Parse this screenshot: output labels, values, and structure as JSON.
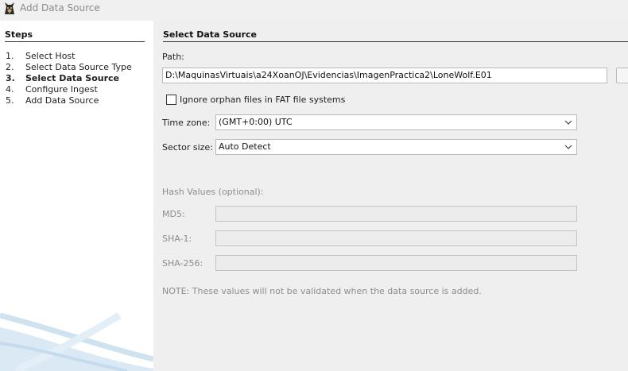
{
  "window": {
    "title": "Add Data Source"
  },
  "steps": {
    "title": "Steps",
    "items": [
      {
        "num": "1.",
        "label": "Select Host",
        "active": false
      },
      {
        "num": "2.",
        "label": "Select Data Source Type",
        "active": false
      },
      {
        "num": "3.",
        "label": "Select Data Source",
        "active": true
      },
      {
        "num": "4.",
        "label": "Configure Ingest",
        "active": false
      },
      {
        "num": "5.",
        "label": "Add Data Source",
        "active": false
      }
    ]
  },
  "form": {
    "title": "Select Data Source",
    "path_label": "Path:",
    "path_value": "D:\\MaquinasVirtuais\\a24XoanOJ\\Evidencias\\ImagenPractica2\\LoneWolf.E01",
    "ignore_orphan_label": "Ignore orphan files in FAT file systems",
    "ignore_orphan_checked": false,
    "timezone_label": "Time zone:",
    "timezone_value": "(GMT+0:00) UTC",
    "sector_label": "Sector size:",
    "sector_value": "Auto Detect",
    "hash_label": "Hash Values (optional):",
    "md5_label": "MD5:",
    "md5_value": "",
    "sha1_label": "SHA-1:",
    "sha1_value": "",
    "sha256_label": "SHA-256:",
    "sha256_value": "",
    "note": "NOTE: These values will not be validated when the data source is added."
  },
  "icons": {
    "app": "autopsy-dog-icon",
    "dropdown": "chevron-down-icon"
  },
  "colors": {
    "left_panel_bg": "#ffffff",
    "right_panel_bg": "#efefef",
    "disabled_text": "#8d8d8d"
  }
}
